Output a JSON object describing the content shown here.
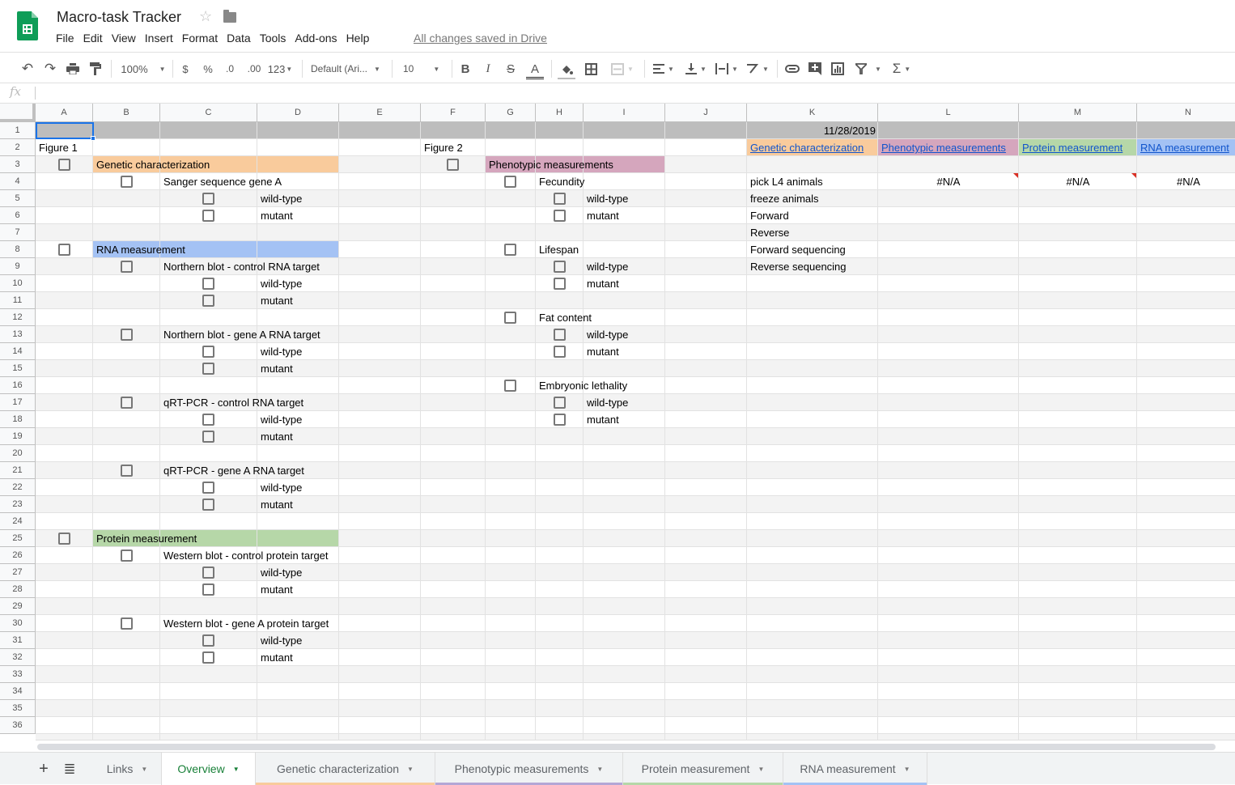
{
  "app": {
    "title": "Macro-task Tracker",
    "save_status": "All changes saved in Drive",
    "menu": [
      "File",
      "Edit",
      "View",
      "Insert",
      "Format",
      "Data",
      "Tools",
      "Add-ons",
      "Help"
    ]
  },
  "toolbar": {
    "zoom": "100%",
    "currency": "$",
    "percent": "%",
    "decrease_decimal": ".0",
    "increase_decimal": ".00",
    "more_formats": "123",
    "font": "Default (Ari...",
    "font_size": "10",
    "bold": "B",
    "italic": "I",
    "strikethrough": "S",
    "text_color": "A",
    "sum": "Σ"
  },
  "formula_bar": {
    "label": "fx",
    "value": ""
  },
  "columns": [
    "A",
    "B",
    "C",
    "D",
    "E",
    "F",
    "G",
    "H",
    "I",
    "J",
    "K",
    "L",
    "M",
    "N"
  ],
  "rows": [
    "1",
    "2",
    "3",
    "4",
    "5",
    "6",
    "7",
    "8",
    "9",
    "10",
    "11",
    "12",
    "13",
    "14",
    "15",
    "16",
    "17",
    "18",
    "19",
    "20",
    "21",
    "22",
    "23",
    "24",
    "25",
    "26",
    "27",
    "28",
    "29",
    "30",
    "31",
    "32",
    "33",
    "34",
    "35",
    "36"
  ],
  "colors": {
    "genetic": "#f9cb9c",
    "phenotypic": "#d5a6bd",
    "protein": "#b6d7a8",
    "rna": "#a4c2f4",
    "header_row": "#bdbdbd",
    "active_tab": "#188038",
    "tab_phenotypic_underline": "#b4a7d6"
  },
  "cells": {
    "K1": "11/28/2019",
    "A2": "Figure 1",
    "F2": "Figure 2",
    "B3": "Genetic characterization",
    "G3": "Phenotypic measurements",
    "C4": "Sanger sequence gene A",
    "D5": "wild-type",
    "D6": "mutant",
    "B8": "RNA measurement",
    "C9": "Northern blot - control RNA target",
    "D10": "wild-type",
    "D11": "mutant",
    "C13": "Northern blot - gene A RNA target",
    "D14": "wild-type",
    "D15": "mutant",
    "C17": "qRT-PCR - control RNA target",
    "D18": "wild-type",
    "D19": "mutant",
    "C21": "qRT-PCR - gene A RNA target",
    "D22": "wild-type",
    "D23": "mutant",
    "B25": "Protein measurement",
    "C26": "Western blot - control protein target",
    "D27": "wild-type",
    "D28": "mutant",
    "C30": "Western blot - gene A protein target",
    "D31": "wild-type",
    "D32": "mutant",
    "H4": "Fecundity",
    "I5": "wild-type",
    "I6": "mutant",
    "H8": "Lifespan",
    "I9": "wild-type",
    "I10": "mutant",
    "H12": "Fat content",
    "I13": "wild-type",
    "I14": "mutant",
    "H16": "Embryonic lethality",
    "I17": "wild-type",
    "I18": "mutant",
    "K2": "Genetic characterization",
    "L2": "Phenotypic measurements",
    "M2": "Protein measurement",
    "N2": "RNA measurement",
    "K4": "pick L4 animals",
    "L4": "#N/A",
    "M4": "#N/A",
    "N4": "#N/A",
    "K5": "freeze animals",
    "K6": "Forward",
    "K7": "Reverse",
    "K8": "Forward sequencing",
    "K9": "Reverse sequencing"
  },
  "checkboxes": {
    "A3": false,
    "B4": false,
    "C5": false,
    "C6": false,
    "A8": false,
    "B9": false,
    "C10": false,
    "C11": false,
    "B13": false,
    "C14": false,
    "C15": false,
    "B17": false,
    "C18": false,
    "C19": false,
    "B21": false,
    "C22": false,
    "C23": false,
    "A25": false,
    "B26": false,
    "C27": false,
    "C28": false,
    "B30": false,
    "C31": false,
    "C32": false,
    "F3": false,
    "G4": false,
    "H5": false,
    "H6": false,
    "G8": false,
    "H9": false,
    "H10": false,
    "G12": false,
    "H13": false,
    "H14": false,
    "G16": false,
    "H17": false,
    "H18": false
  },
  "sheet_tabs": [
    {
      "label": "Links",
      "active": false,
      "color": ""
    },
    {
      "label": "Overview",
      "active": true,
      "color": ""
    },
    {
      "label": "Genetic characterization",
      "active": false,
      "color": "#f9cb9c"
    },
    {
      "label": "Phenotypic measurements",
      "active": false,
      "color": "#b4a7d6"
    },
    {
      "label": "Protein measurement",
      "active": false,
      "color": "#b6d7a8"
    },
    {
      "label": "RNA measurement",
      "active": false,
      "color": "#a4c2f4"
    }
  ],
  "tab_bar": {
    "add_sheet": "+",
    "all_sheets": "≣"
  }
}
